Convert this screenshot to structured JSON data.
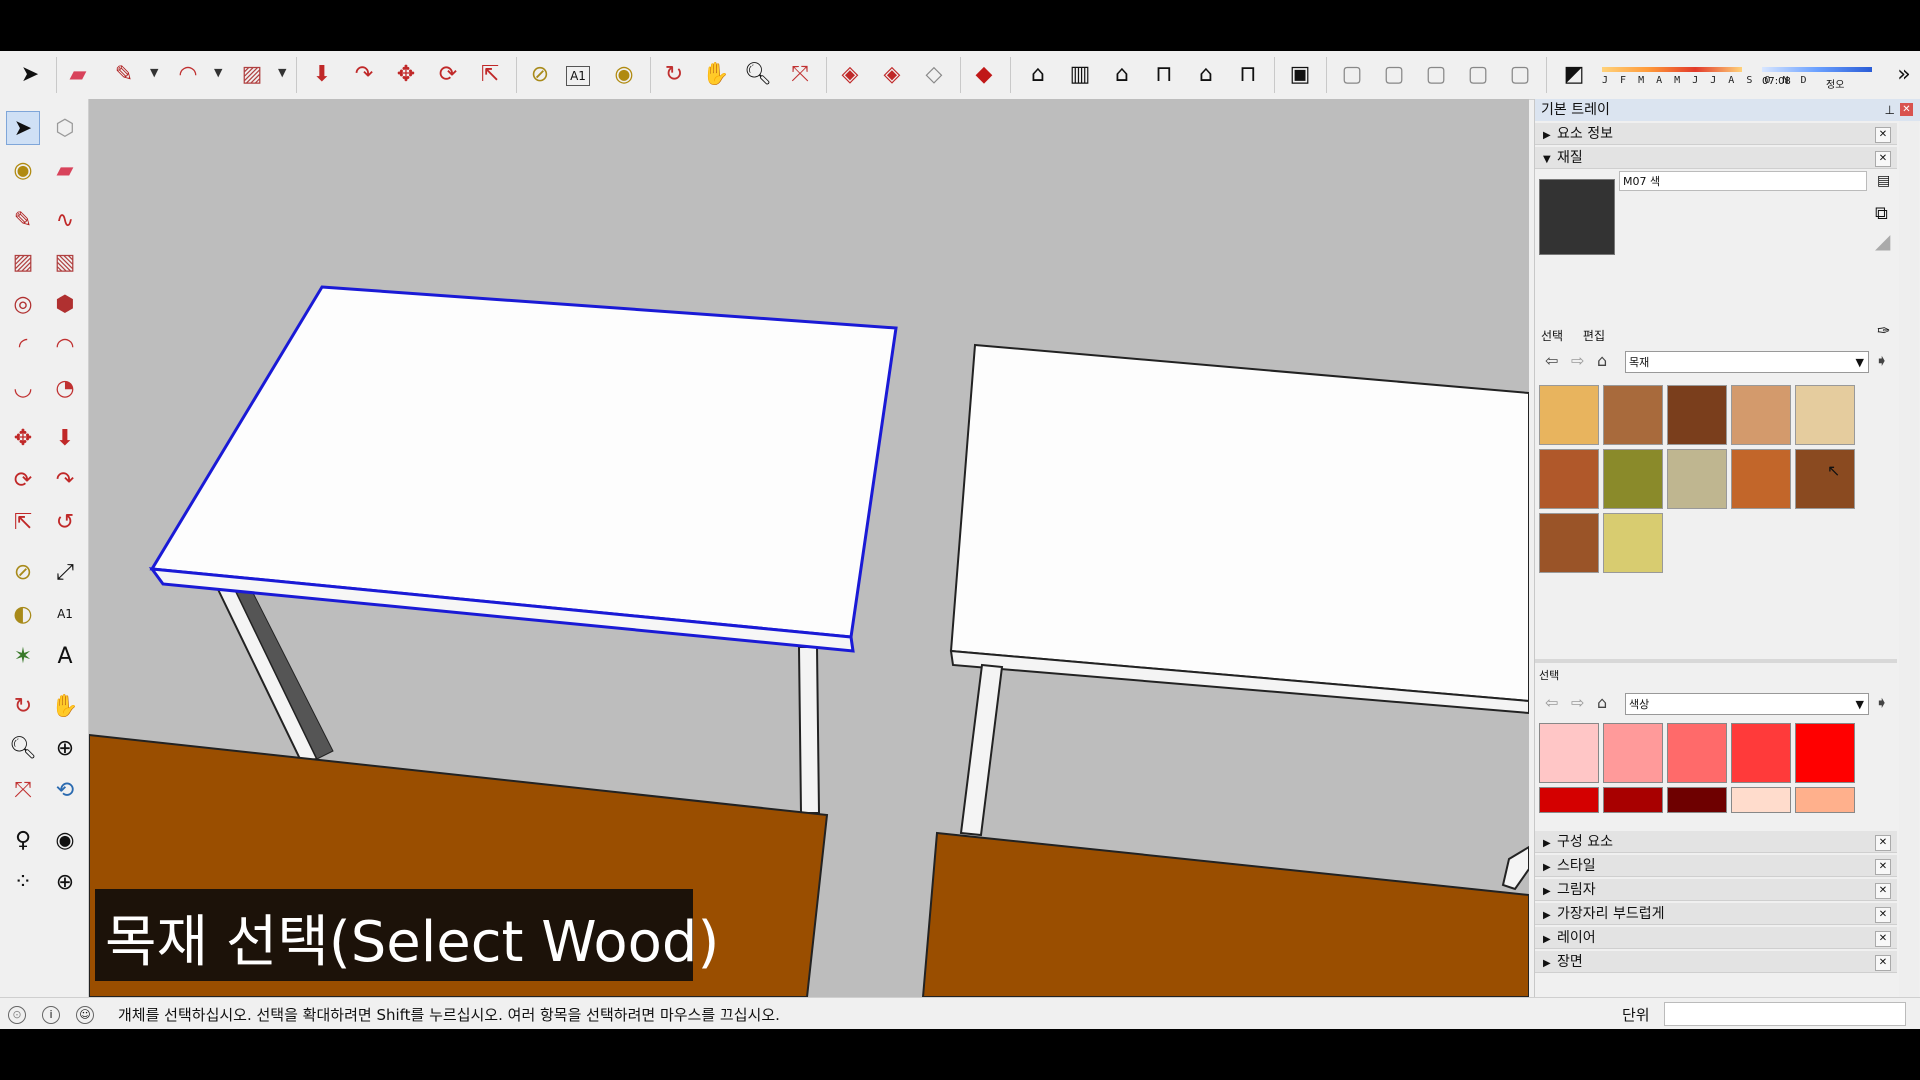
{
  "toolbar": {
    "months": "J F M A M J J A S O N D",
    "time_left": "07:08",
    "time_right": "정오"
  },
  "viewport": {
    "caption": "목재 선택(Select Wood)"
  },
  "tray": {
    "title": "기본 트레이",
    "sections_top": [
      "요소 정보",
      "재질"
    ],
    "material_name": "M07 색",
    "tabs": [
      "선택",
      "편집"
    ],
    "library_top": "목재",
    "secondary_label": "선택",
    "library_bottom": "색상",
    "sections_bottom": [
      "구성 요소",
      "스타일",
      "그림자",
      "가장자리 부드럽게",
      "레이어",
      "장면"
    ]
  },
  "status": {
    "message": "개체를 선택하십시오. 선택을 확대하려면 Shift를 누르십시오. 여러 항목을 선택하려면 마우스를 끄십시오.",
    "unit_label": "단위"
  },
  "colors": {
    "selection_blue": "#1a1ad6",
    "floor_brown": "#9a4e00",
    "wood_textures": [
      "#e8b45e",
      "#a86a3c",
      "#7a3e1c",
      "#d39a6c",
      "#e5cc9e",
      "#b0582a",
      "#8a8a2a",
      "#bfb690",
      "#c2662a",
      "#8a4a20",
      "#9a5428",
      "#d8cc70"
    ],
    "red_swatches": [
      "#ffc6c6",
      "#ff9a9a",
      "#ff6a6a",
      "#ff3a3a",
      "#ff0000",
      "#d40000",
      "#a80000",
      "#6e0000",
      "#ffdccc",
      "#ffb08c"
    ]
  }
}
